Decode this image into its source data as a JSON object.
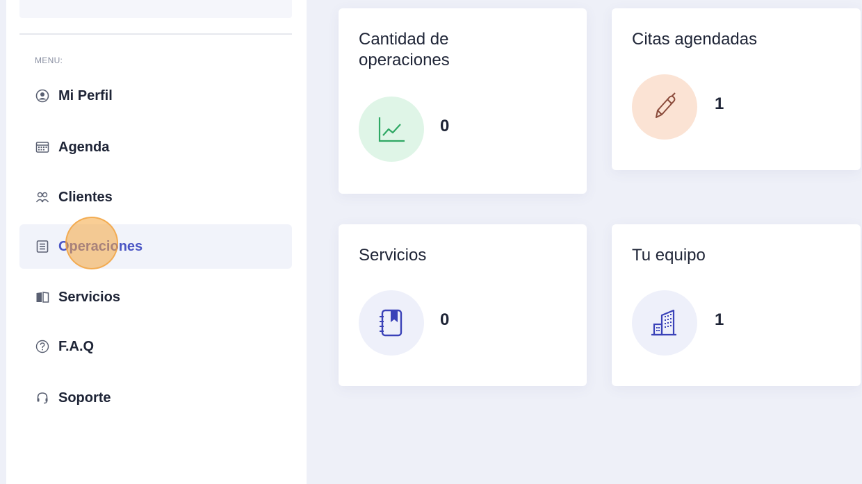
{
  "sidebar": {
    "menu_label": "MENU:",
    "items": [
      {
        "label": "Mi Perfil",
        "icon": "user-circle-icon"
      },
      {
        "label": "Agenda",
        "icon": "calendar-icon"
      },
      {
        "label": "Clientes",
        "icon": "users-icon"
      },
      {
        "label": "Operaciones",
        "icon": "document-list-icon",
        "active": true
      },
      {
        "label": "Servicios",
        "icon": "book-open-icon"
      },
      {
        "label": "F.A.Q",
        "icon": "question-circle-icon"
      },
      {
        "label": "Soporte",
        "icon": "headset-icon"
      }
    ]
  },
  "cards": [
    {
      "title": "Cantidad de operaciones",
      "value": "0",
      "icon": "line-chart-icon"
    },
    {
      "title": "Citas agendadas",
      "value": "1",
      "icon": "pencil-icon"
    },
    {
      "title": "Servicios",
      "value": "0",
      "icon": "notebook-icon"
    },
    {
      "title": "Tu equipo",
      "value": "1",
      "icon": "building-icon"
    }
  ],
  "colors": {
    "accent": "#4a55c4",
    "chart_icon_bg": "#dff5e7",
    "chart_icon_stroke": "#2fa864",
    "pencil_icon_bg": "#fbe3d4",
    "pencil_icon_stroke": "#8a4a3a",
    "notebook_icon_bg": "#eef0fa",
    "building_icon_bg": "#eef0fa",
    "icon_blue": "#3a42b8"
  }
}
